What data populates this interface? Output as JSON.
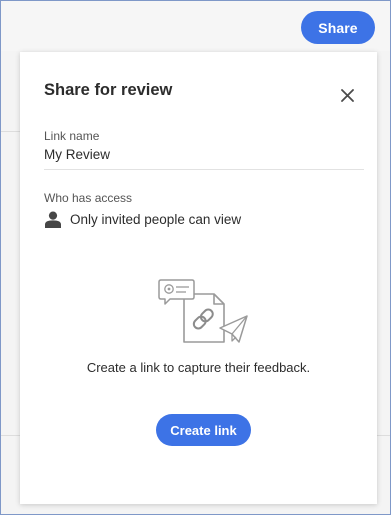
{
  "header": {
    "share_label": "Share"
  },
  "panel": {
    "title": "Share for review",
    "close_icon": "close-icon",
    "link_name": {
      "label": "Link name",
      "value": "My Review"
    },
    "access": {
      "label": "Who has access",
      "icon": "person-icon",
      "value": "Only invited people can view"
    },
    "illustration_icon": "share-link-illustration-icon",
    "caption": "Create a link to capture their feedback.",
    "create_label": "Create link"
  },
  "colors": {
    "accent": "#3d73e6",
    "frame_border": "#7f98c8"
  }
}
